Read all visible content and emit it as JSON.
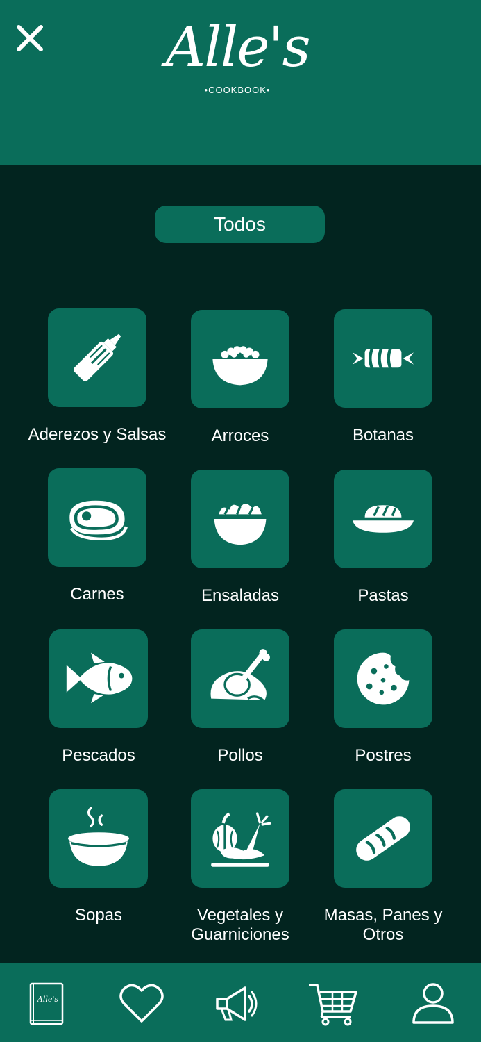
{
  "header": {
    "logo_script": "Alle's",
    "logo_sub": "•COOKBOOK•",
    "close_icon": "close-icon"
  },
  "filter": {
    "todos_label": "Todos"
  },
  "categories": [
    {
      "label": "Aderezos y Salsas",
      "icon": "sauce-bottle-icon"
    },
    {
      "label": "Arroces",
      "icon": "rice-bowl-icon"
    },
    {
      "label": "Botanas",
      "icon": "snack-candy-icon"
    },
    {
      "label": "Carnes",
      "icon": "steak-icon"
    },
    {
      "label": "Ensaladas",
      "icon": "salad-bowl-icon"
    },
    {
      "label": "Pastas",
      "icon": "pasta-dish-icon"
    },
    {
      "label": "Pescados",
      "icon": "fish-icon"
    },
    {
      "label": "Pollos",
      "icon": "roast-chicken-icon"
    },
    {
      "label": "Postres",
      "icon": "cookie-icon"
    },
    {
      "label": "Sopas",
      "icon": "soup-bowl-icon"
    },
    {
      "label": "Vegetales y\nGuarniciones",
      "icon": "vegetables-icon"
    },
    {
      "label": "Masas, Panes y\nOtros",
      "icon": "bread-icon"
    }
  ],
  "bottom_nav": {
    "book_logo_text": "Alle's",
    "items": [
      "cookbook-icon",
      "heart-icon",
      "megaphone-icon",
      "cart-icon",
      "user-icon"
    ]
  },
  "colors": {
    "background": "#02241f",
    "primary": "#0a6d5a",
    "text": "#ffffff"
  }
}
